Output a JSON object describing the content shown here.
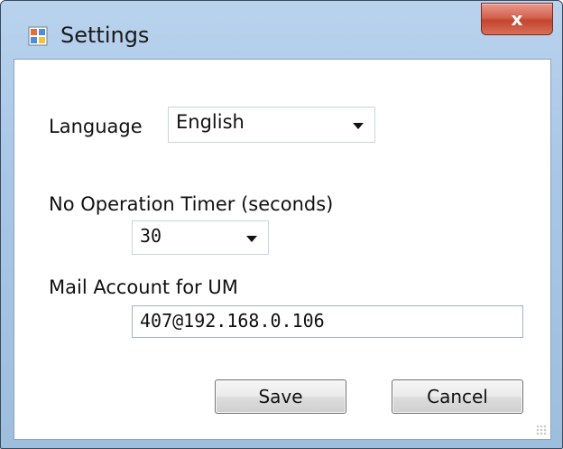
{
  "window": {
    "title": "Settings",
    "close_label": "x"
  },
  "language": {
    "label": "Language",
    "selected": "English"
  },
  "timer": {
    "label": "No Operation Timer (seconds)",
    "selected": "30"
  },
  "mail": {
    "label": "Mail Account for UM",
    "value": "407@192.168.0.106"
  },
  "buttons": {
    "save": "Save",
    "cancel": "Cancel"
  }
}
